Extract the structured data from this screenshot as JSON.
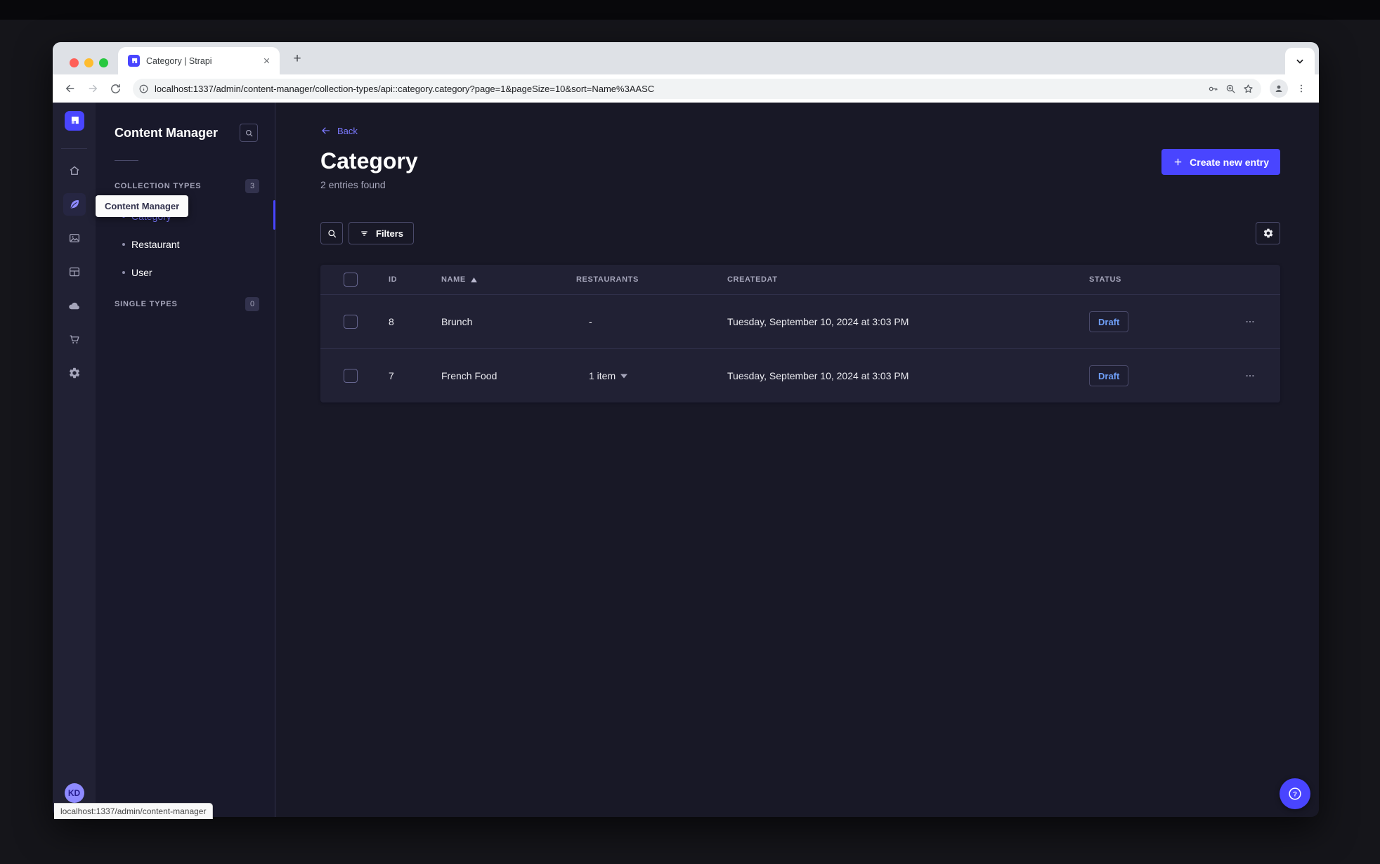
{
  "browser": {
    "tab_title": "Category | Strapi",
    "url": "localhost:1337/admin/content-manager/collection-types/api::category.category?page=1&pageSize=10&sort=Name%3AASC",
    "status_bar_url": "localhost:1337/admin/content-manager"
  },
  "sidebar": {
    "tooltip": "Content Manager",
    "avatar_initials": "KD",
    "nav_icons": [
      "home-icon",
      "content-manager-icon",
      "media-library-icon",
      "content-type-builder-icon",
      "deploy-cloud-icon",
      "marketplace-cart-icon",
      "settings-gear-icon"
    ],
    "active_icon": "content-manager-icon"
  },
  "subnav": {
    "title": "Content Manager",
    "search_icon": "search-icon",
    "collection_section": {
      "label": "COLLECTION TYPES",
      "count": "3"
    },
    "collection_items": [
      {
        "label": "Category",
        "active": true
      },
      {
        "label": "Restaurant",
        "active": false
      },
      {
        "label": "User",
        "active": false
      }
    ],
    "single_section": {
      "label": "SINGLE TYPES",
      "count": "0"
    }
  },
  "main": {
    "back_label": "Back",
    "title": "Category",
    "subtitle": "2 entries found",
    "create_button_label": "Create new entry",
    "filters_button_label": "Filters",
    "table": {
      "headers": {
        "id": "ID",
        "name": "NAME",
        "restaurants": "RESTAURANTS",
        "createdat": "CREATEDAT",
        "status": "STATUS"
      },
      "sorted_by": "NAME ascending",
      "rows": [
        {
          "id": "8",
          "name": "Brunch",
          "restaurants": "-",
          "createdat": "Tuesday, September 10, 2024 at 3:03 PM",
          "status": "Draft"
        },
        {
          "id": "7",
          "name": "French Food",
          "restaurants": "1 item",
          "createdat": "Tuesday, September 10, 2024 at 3:03 PM",
          "status": "Draft"
        }
      ]
    }
  },
  "colors": {
    "primary": "#4945ff",
    "primary_light": "#7b79ff",
    "surface": "#212134",
    "background": "#181826",
    "border": "#32324d",
    "muted_text": "#a5a5ba",
    "draft_text": "#6f9ff8"
  }
}
